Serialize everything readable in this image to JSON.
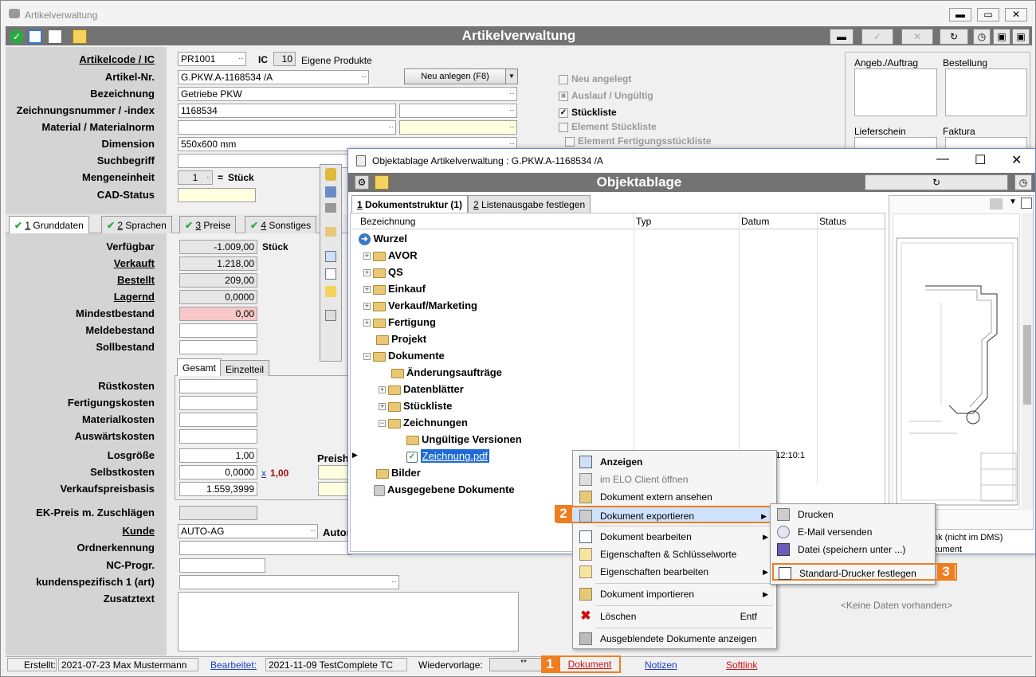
{
  "window": {
    "title": "Artikelverwaltung",
    "header": "Artikelverwaltung"
  },
  "form": {
    "artikelcode_label": "Artikelcode / IC",
    "artikelcode_value": "PR1001",
    "ic_label": "IC",
    "ic_value": "10",
    "ic_text": "Eigene Produkte",
    "artikelnr_label": "Artikel-Nr.",
    "artikelnr_value": "G.PKW.A-1168534 /A",
    "neu_anlegen": "Neu anlegen (F8)",
    "bezeichnung_label": "Bezeichnung",
    "bezeichnung_value": "Getriebe PKW",
    "zeichnung_label": "Zeichnungsnummer / -index",
    "zeichnung_value": "1168534",
    "material_label": "Material / Materialnorm",
    "dimension_label": "Dimension",
    "dimension_value": "550x600 mm",
    "suchbegriff_label": "Suchbegriff",
    "mengeneinheit_label": "Mengeneinheit",
    "mengeneinheit_value": "1",
    "mengeneinheit_eq": "=",
    "mengeneinheit_unit": "Stück",
    "cad_label": "CAD-Status"
  },
  "checks": {
    "neu_angelegt": "Neu angelegt",
    "auslauf": "Auslauf / Ungültig",
    "stueckliste": "Stückliste",
    "element_stueckliste": "Element Stückliste",
    "element_fertigung": "Element Fertigungsstückliste"
  },
  "right_boxes": {
    "angeb": "Angeb./Auftrag",
    "bestellung": "Bestellung",
    "lieferschein": "Lieferschein",
    "faktura": "Faktura",
    "keine_daten": "<Keine Daten vorhanden>"
  },
  "tabs": [
    {
      "num": "1",
      "label": " Grunddaten"
    },
    {
      "num": "2",
      "label": " Sprachen"
    },
    {
      "num": "3",
      "label": " Preise"
    },
    {
      "num": "4",
      "label": " Sonstiges"
    }
  ],
  "stock": {
    "verfuegbar_label": "Verfügbar",
    "verfuegbar": "-1.009,00",
    "unit": "Stück",
    "verkauft_label": "Verkauft",
    "verkauft": "1.218,00",
    "bestellt_label": "Bestellt",
    "bestellt": "209,00",
    "lagernd_label": "Lagernd",
    "lagernd": "0,0000",
    "mindest_label": "Mindestbestand",
    "mindest": "0,00",
    "melde_label": "Meldebestand",
    "soll_label": "Sollbestand"
  },
  "subtabs": {
    "gesamt": "Gesamt",
    "einzelteil": "Einzelteil"
  },
  "costs": {
    "ruest": "Rüstkosten",
    "fertigung": "Fertigungskosten",
    "material": "Materialkosten",
    "auswaerts": "Auswärtskosten",
    "losgroesse_label": "Losgröße",
    "losgroesse": "1,00",
    "preis_partial": "Preish",
    "selbstkosten_label": "Selbstkosten",
    "selbstkosten": "0,0000",
    "x": "x",
    "factor": "1,00",
    "vk_label": "Verkaufspreisbasis",
    "vk": "1.559,3999"
  },
  "customer": {
    "ek_label": "EK-Preis m. Zuschlägen",
    "kunde_label": "Kunde",
    "kunde_value": "AUTO-AG",
    "auto_partial": "Autor",
    "ordner_label": "Ordnerkennung",
    "nc_label": "NC-Progr.",
    "kunden_label": "kundenspezifisch 1 (art)",
    "zusatz_label": "Zusatztext"
  },
  "status": {
    "erstellt_label": "Erstellt:",
    "erstellt": "2021-07-23  Max Mustermann",
    "bearbeitet_label": "Bearbeitet:",
    "bearbeitet": "2021-11-09  TestComplete TC",
    "wieder_label": "Wiedervorlage:",
    "wieder_value": "**",
    "dokument": "Dokument",
    "notizen": "Notizen",
    "softlink": "Softlink"
  },
  "objekt": {
    "title": "Objektablage Artikelverwaltung : G.PKW.A-1168534 /A",
    "header": "Objektablage",
    "tab1_num": "1",
    "tab1": " Dokumentstruktur (1)",
    "tab2_num": "2",
    "tab2": " Listenausgabe festlegen",
    "columns": [
      "Bezeichnung",
      "Typ",
      "Datum",
      "Status"
    ],
    "root": "Wurzel",
    "tree": [
      "AVOR",
      "QS",
      "Einkauf",
      "Verkauf/Marketing",
      "Fertigung",
      "Projekt",
      "Dokumente",
      "Änderungsaufträge",
      "Datenblätter",
      "Stückliste",
      "Zeichnungen",
      "Ungültige Versionen",
      "Zeichnung.pdf",
      "Bilder",
      "Ausgegebene Dokumente"
    ],
    "file_date": "21 12:10:1",
    "preview_text1": "nk (nicht im DMS)",
    "preview_text2": "kument"
  },
  "context_menu": [
    "Anzeigen",
    "im ELO Client öffnen",
    "Dokument extern ansehen",
    "Dokument exportieren",
    "Dokument bearbeiten",
    "Eigenschaften & Schlüsselworte",
    "Eigenschaften bearbeiten",
    "Dokument importieren",
    "Löschen",
    "Ausgeblendete Dokumente anzeigen"
  ],
  "delete_shortcut": "Entf",
  "submenu": [
    "Drucken",
    "E-Mail versenden",
    "Datei (speichern unter ...)",
    "Standard-Drucker festlegen"
  ],
  "badges": [
    "1",
    "2",
    "3"
  ],
  "colors": {
    "header": "#737373",
    "accent": "#f07d1e",
    "select": "#1e6ad4"
  }
}
